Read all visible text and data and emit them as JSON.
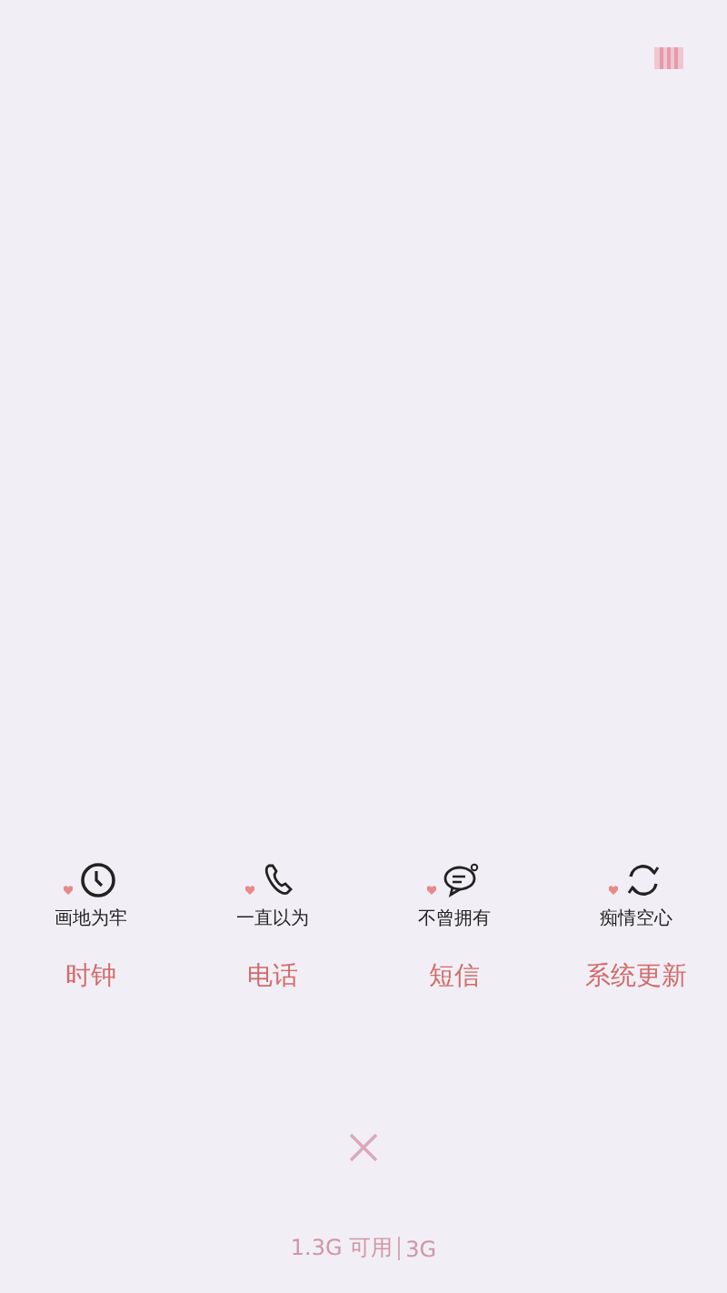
{
  "apps": [
    {
      "kind": "clock",
      "caption": "画地为牢",
      "label": "时钟"
    },
    {
      "kind": "phone",
      "caption": "一直以为",
      "label": "电话"
    },
    {
      "kind": "message",
      "caption": "不曾拥有",
      "label": "短信"
    },
    {
      "kind": "update",
      "caption": "痴情空心",
      "label": "系统更新"
    }
  ],
  "memory": {
    "available": "1.3G 可用",
    "total": "3G"
  }
}
